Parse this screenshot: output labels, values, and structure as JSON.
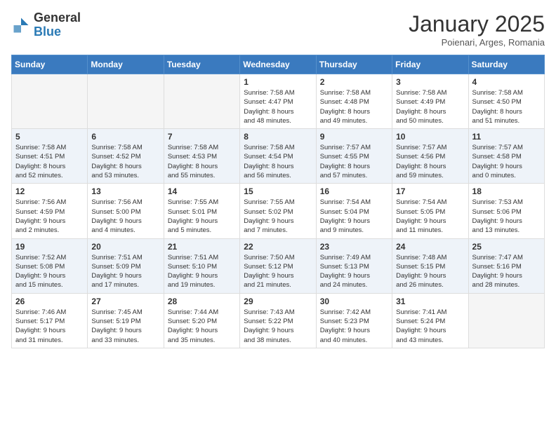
{
  "header": {
    "logo_general": "General",
    "logo_blue": "Blue",
    "title": "January 2025",
    "subtitle": "Poienari, Arges, Romania"
  },
  "weekdays": [
    "Sunday",
    "Monday",
    "Tuesday",
    "Wednesday",
    "Thursday",
    "Friday",
    "Saturday"
  ],
  "weeks": [
    [
      {
        "day": null
      },
      {
        "day": null
      },
      {
        "day": null
      },
      {
        "day": "1",
        "sunrise": "7:58 AM",
        "sunset": "4:47 PM",
        "daylight_hours": "8",
        "daylight_minutes": "48"
      },
      {
        "day": "2",
        "sunrise": "7:58 AM",
        "sunset": "4:48 PM",
        "daylight_hours": "8",
        "daylight_minutes": "49"
      },
      {
        "day": "3",
        "sunrise": "7:58 AM",
        "sunset": "4:49 PM",
        "daylight_hours": "8",
        "daylight_minutes": "50"
      },
      {
        "day": "4",
        "sunrise": "7:58 AM",
        "sunset": "4:50 PM",
        "daylight_hours": "8",
        "daylight_minutes": "51"
      }
    ],
    [
      {
        "day": "5",
        "sunrise": "7:58 AM",
        "sunset": "4:51 PM",
        "daylight_hours": "8",
        "daylight_minutes": "52"
      },
      {
        "day": "6",
        "sunrise": "7:58 AM",
        "sunset": "4:52 PM",
        "daylight_hours": "8",
        "daylight_minutes": "53"
      },
      {
        "day": "7",
        "sunrise": "7:58 AM",
        "sunset": "4:53 PM",
        "daylight_hours": "8",
        "daylight_minutes": "55"
      },
      {
        "day": "8",
        "sunrise": "7:58 AM",
        "sunset": "4:54 PM",
        "daylight_hours": "8",
        "daylight_minutes": "56"
      },
      {
        "day": "9",
        "sunrise": "7:57 AM",
        "sunset": "4:55 PM",
        "daylight_hours": "8",
        "daylight_minutes": "57"
      },
      {
        "day": "10",
        "sunrise": "7:57 AM",
        "sunset": "4:56 PM",
        "daylight_hours": "8",
        "daylight_minutes": "59"
      },
      {
        "day": "11",
        "sunrise": "7:57 AM",
        "sunset": "4:58 PM",
        "daylight_hours": "9",
        "daylight_minutes": "0"
      }
    ],
    [
      {
        "day": "12",
        "sunrise": "7:56 AM",
        "sunset": "4:59 PM",
        "daylight_hours": "9",
        "daylight_minutes": "2"
      },
      {
        "day": "13",
        "sunrise": "7:56 AM",
        "sunset": "5:00 PM",
        "daylight_hours": "9",
        "daylight_minutes": "4"
      },
      {
        "day": "14",
        "sunrise": "7:55 AM",
        "sunset": "5:01 PM",
        "daylight_hours": "9",
        "daylight_minutes": "5"
      },
      {
        "day": "15",
        "sunrise": "7:55 AM",
        "sunset": "5:02 PM",
        "daylight_hours": "9",
        "daylight_minutes": "7"
      },
      {
        "day": "16",
        "sunrise": "7:54 AM",
        "sunset": "5:04 PM",
        "daylight_hours": "9",
        "daylight_minutes": "9"
      },
      {
        "day": "17",
        "sunrise": "7:54 AM",
        "sunset": "5:05 PM",
        "daylight_hours": "9",
        "daylight_minutes": "11"
      },
      {
        "day": "18",
        "sunrise": "7:53 AM",
        "sunset": "5:06 PM",
        "daylight_hours": "9",
        "daylight_minutes": "13"
      }
    ],
    [
      {
        "day": "19",
        "sunrise": "7:52 AM",
        "sunset": "5:08 PM",
        "daylight_hours": "9",
        "daylight_minutes": "15"
      },
      {
        "day": "20",
        "sunrise": "7:51 AM",
        "sunset": "5:09 PM",
        "daylight_hours": "9",
        "daylight_minutes": "17"
      },
      {
        "day": "21",
        "sunrise": "7:51 AM",
        "sunset": "5:10 PM",
        "daylight_hours": "9",
        "daylight_minutes": "19"
      },
      {
        "day": "22",
        "sunrise": "7:50 AM",
        "sunset": "5:12 PM",
        "daylight_hours": "9",
        "daylight_minutes": "21"
      },
      {
        "day": "23",
        "sunrise": "7:49 AM",
        "sunset": "5:13 PM",
        "daylight_hours": "9",
        "daylight_minutes": "24"
      },
      {
        "day": "24",
        "sunrise": "7:48 AM",
        "sunset": "5:15 PM",
        "daylight_hours": "9",
        "daylight_minutes": "26"
      },
      {
        "day": "25",
        "sunrise": "7:47 AM",
        "sunset": "5:16 PM",
        "daylight_hours": "9",
        "daylight_minutes": "28"
      }
    ],
    [
      {
        "day": "26",
        "sunrise": "7:46 AM",
        "sunset": "5:17 PM",
        "daylight_hours": "9",
        "daylight_minutes": "31"
      },
      {
        "day": "27",
        "sunrise": "7:45 AM",
        "sunset": "5:19 PM",
        "daylight_hours": "9",
        "daylight_minutes": "33"
      },
      {
        "day": "28",
        "sunrise": "7:44 AM",
        "sunset": "5:20 PM",
        "daylight_hours": "9",
        "daylight_minutes": "35"
      },
      {
        "day": "29",
        "sunrise": "7:43 AM",
        "sunset": "5:22 PM",
        "daylight_hours": "9",
        "daylight_minutes": "38"
      },
      {
        "day": "30",
        "sunrise": "7:42 AM",
        "sunset": "5:23 PM",
        "daylight_hours": "9",
        "daylight_minutes": "40"
      },
      {
        "day": "31",
        "sunrise": "7:41 AM",
        "sunset": "5:24 PM",
        "daylight_hours": "9",
        "daylight_minutes": "43"
      },
      {
        "day": null
      }
    ]
  ]
}
